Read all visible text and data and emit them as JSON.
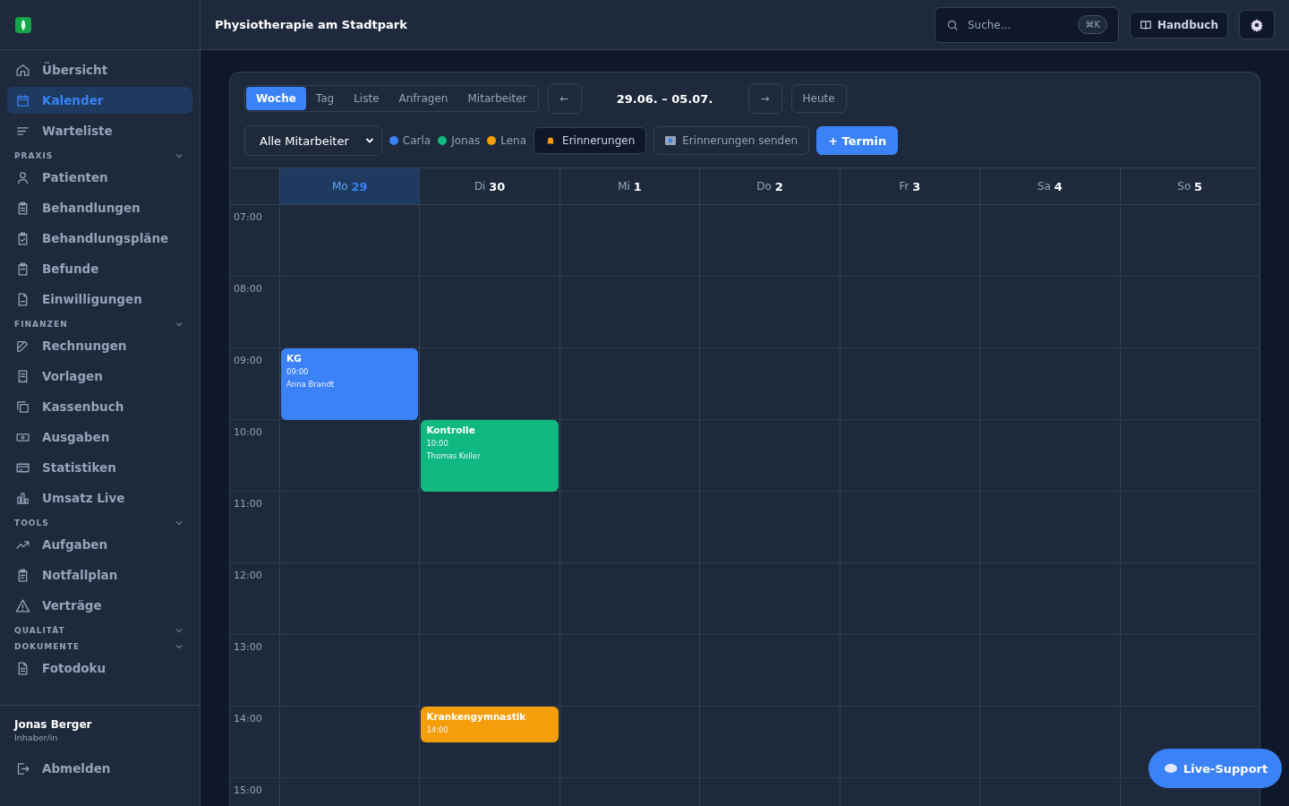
{
  "header": {
    "title": "Physiotherapie am Stadtpark",
    "search": {
      "placeholder": "Suche...",
      "shortcut": "⌘K"
    },
    "manual_button": "Handbuch"
  },
  "sidebar": {
    "groups": [
      {
        "items": [
          {
            "label": "Übersicht",
            "selected": false
          },
          {
            "label": "Kalender",
            "selected": true
          },
          {
            "label": "Warteliste",
            "selected": false
          }
        ]
      },
      {
        "heading": "PRAXIS",
        "items": [
          {
            "label": "Patienten",
            "selected": false
          },
          {
            "label": "Behandlungen",
            "selected": false
          },
          {
            "label": "Behandlungspläne",
            "selected": false
          },
          {
            "label": "Befunde",
            "selected": false
          },
          {
            "label": "Einwilligungen",
            "selected": false
          }
        ]
      },
      {
        "heading": "FINANZEN",
        "items": [
          {
            "label": "Rechnungen",
            "selected": false
          },
          {
            "label": "Vorlagen",
            "selected": false
          },
          {
            "label": "Kassenbuch",
            "selected": false
          },
          {
            "label": "Ausgaben",
            "selected": false
          },
          {
            "label": "Statistiken",
            "selected": false
          },
          {
            "label": "Umsatz Live",
            "selected": false
          }
        ]
      },
      {
        "heading": "TOOLS",
        "items": [
          {
            "label": "Aufgaben",
            "selected": false
          },
          {
            "label": "Notfallplan",
            "selected": false
          },
          {
            "label": "Verträge",
            "selected": false
          }
        ]
      },
      {
        "heading": "QUALITÄT"
      },
      {
        "heading": "DOKUMENTE",
        "items": [
          {
            "label": "Fotodoku",
            "selected": false
          }
        ]
      }
    ],
    "user": {
      "name": "Jonas Berger",
      "role": "Inhaber/in"
    },
    "logout": "Abmelden"
  },
  "calendar": {
    "views": [
      {
        "label": "Woche",
        "selected": true
      },
      {
        "label": "Tag",
        "selected": false
      },
      {
        "label": "Liste",
        "selected": false
      },
      {
        "label": "Anfragen",
        "selected": false
      },
      {
        "label": "Mitarbeiter",
        "selected": false
      }
    ],
    "prev": "←",
    "range": "29.06. – 05.07.",
    "next": "→",
    "today": "Heute",
    "staff_filter": "Alle Mitarbeiter",
    "legend": [
      {
        "name": "Carla",
        "color": "#3b82f6"
      },
      {
        "name": "Jonas",
        "color": "#10b981"
      },
      {
        "name": "Lena",
        "color": "#f59e0b"
      }
    ],
    "reminders": "Erinnerungen",
    "send_reminders": "Erinnerungen senden",
    "new_appointment": "+ Termin",
    "hours": [
      "07:00",
      "08:00",
      "09:00",
      "10:00",
      "11:00",
      "12:00",
      "13:00",
      "14:00",
      "15:00"
    ],
    "days": [
      {
        "weekday": "Mo",
        "date": "29",
        "selected": true,
        "events": [
          {
            "title": "KG",
            "time": "09:00",
            "patient": "Anna Brandt",
            "kind": "full",
            "color": "#3b82f6"
          }
        ]
      },
      {
        "weekday": "Di",
        "date": "30",
        "selected": false,
        "events": [
          {
            "title": "Kontrolle",
            "time": "10:00",
            "patient": "Thomas Keller",
            "kind": "full",
            "color": "#10b981"
          },
          {
            "title": "Krankengymnastik",
            "time": "14:00",
            "kind": "half",
            "color": "#f59e0b"
          }
        ]
      },
      {
        "weekday": "Mi",
        "date": "1",
        "selected": false
      },
      {
        "weekday": "Do",
        "date": "2",
        "selected": false
      },
      {
        "weekday": "Fr",
        "date": "3",
        "selected": false
      },
      {
        "weekday": "Sa",
        "date": "4",
        "selected": false
      },
      {
        "weekday": "So",
        "date": "5",
        "selected": false
      }
    ]
  },
  "support_button": "Live-Support"
}
